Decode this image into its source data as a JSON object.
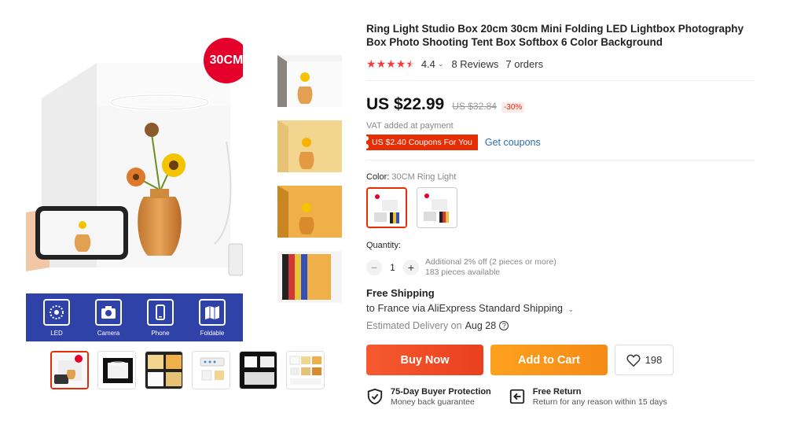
{
  "gallery": {
    "main_badge": "30CM",
    "features": [
      {
        "icon": "led-ring-icon",
        "label": "LED"
      },
      {
        "icon": "camera-icon",
        "label": "Camera"
      },
      {
        "icon": "phone-icon",
        "label": "Phone"
      },
      {
        "icon": "foldable-icon",
        "label": "Foldable"
      }
    ],
    "side_thumbnails": [
      "white-light",
      "warm-light",
      "orange-light",
      "color-backgrounds"
    ],
    "thumbnails_count": 6,
    "active_thumbnail": 0
  },
  "product": {
    "title": "Ring Light Studio Box 20cm 30cm Mini Folding LED Lightbox Photography Box Photo Shooting Tent Box Softbox 6 Color Background",
    "rating": "4.4",
    "stars_filled": 4.5,
    "reviews": "8 Reviews",
    "orders": "7 orders",
    "price": "US $22.99",
    "old_price": "US $32.84",
    "discount": "-30%",
    "vat": "VAT added at payment",
    "coupon": "US $2.40 Coupons For You",
    "get_coupons": "Get coupons",
    "color_label": "Color:",
    "color_value": "30CM Ring Light",
    "color_options_selected": 0,
    "quantity_label": "Quantity:",
    "quantity_value": "1",
    "quantity_note_1": "Additional 2% off (2 pieces or more)",
    "quantity_note_2": "183 pieces available"
  },
  "shipping": {
    "title": "Free Shipping",
    "line": "to France via AliExpress Standard Shipping",
    "delivery_label": "Estimated Delivery on",
    "delivery_date": "Aug 28"
  },
  "actions": {
    "buy_now": "Buy Now",
    "add_to_cart": "Add to Cart",
    "wishlist_count": "198"
  },
  "guarantees": [
    {
      "title": "75-Day Buyer Protection",
      "sub": "Money back guarantee"
    },
    {
      "title": "Free Return",
      "sub": "Return for any reason within 15 days"
    }
  ],
  "colors": {
    "accent": "#e62e04",
    "buy_now": "#f65a2f",
    "add_to_cart": "#fda11e",
    "link": "#2b6cb0",
    "feature_bar": "#2e42a8"
  }
}
